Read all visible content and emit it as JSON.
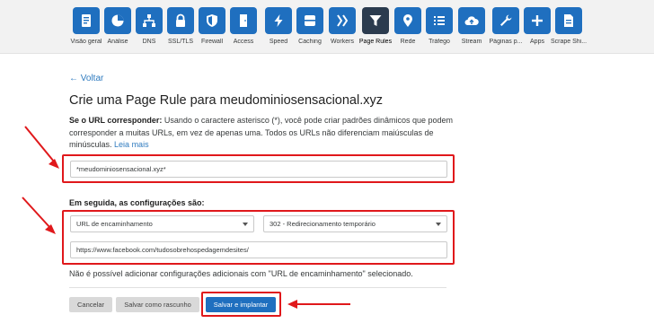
{
  "nav": {
    "items": [
      {
        "label": "Visão geral",
        "icon": "document-icon",
        "active": false
      },
      {
        "label": "Análise",
        "icon": "pie-chart-icon",
        "active": false
      },
      {
        "label": "DNS",
        "icon": "network-icon",
        "active": false
      },
      {
        "label": "SSL/TLS",
        "icon": "lock-icon",
        "active": false
      },
      {
        "label": "Firewall",
        "icon": "shield-icon",
        "active": false
      },
      {
        "label": "Access",
        "icon": "door-icon",
        "active": false
      },
      {
        "label": "Speed",
        "icon": "lightning-icon",
        "active": false
      },
      {
        "label": "Caching",
        "icon": "server-icon",
        "active": false
      },
      {
        "label": "Workers",
        "icon": "workers-icon",
        "active": false
      },
      {
        "label": "Page Rules",
        "icon": "filter-icon",
        "active": true
      },
      {
        "label": "Rede",
        "icon": "location-pin-icon",
        "active": false
      },
      {
        "label": "Tráfego",
        "icon": "list-icon",
        "active": false
      },
      {
        "label": "Stream",
        "icon": "cloud-upload-icon",
        "active": false
      },
      {
        "label": "Páginas p...",
        "icon": "wrench-icon",
        "active": false
      },
      {
        "label": "Apps",
        "icon": "plus-icon",
        "active": false
      },
      {
        "label": "Scrape Shi...",
        "icon": "page-icon",
        "active": false
      }
    ],
    "accent": "#1f6fbf",
    "active_color": "#2b3b4e"
  },
  "page": {
    "back_label": "← Voltar",
    "title": "Crie uma Page Rule para meudominiosensacional.xyz",
    "intro_bold": "Se o URL corresponder:",
    "intro_text": " Usando o caractere asterisco (*), você pode criar padrões dinâmicos que podem corresponder a muitas URLs, em vez de apenas uma. Todos os URLs não diferenciam maiúsculas de minúsculas.",
    "learn_more": "Leia mais",
    "url_pattern_value": "*meudominiosensacional.xyz*",
    "settings_label": "Em seguida, as configurações são:",
    "setting_select": "URL de encaminhamento",
    "status_select": "302 - Redirecionamento temporário",
    "destination_url_value": "https://www.facebook.com/tudosobrehospedagemdesites/",
    "note": "Não é possível adicionar configurações adicionais com \"URL de encaminhamento\" selecionado.",
    "cancel_label": "Cancelar",
    "draft_label": "Salvar como rascunho",
    "deploy_label": "Salvar e implantar"
  },
  "annotation_color": "#e0181b"
}
